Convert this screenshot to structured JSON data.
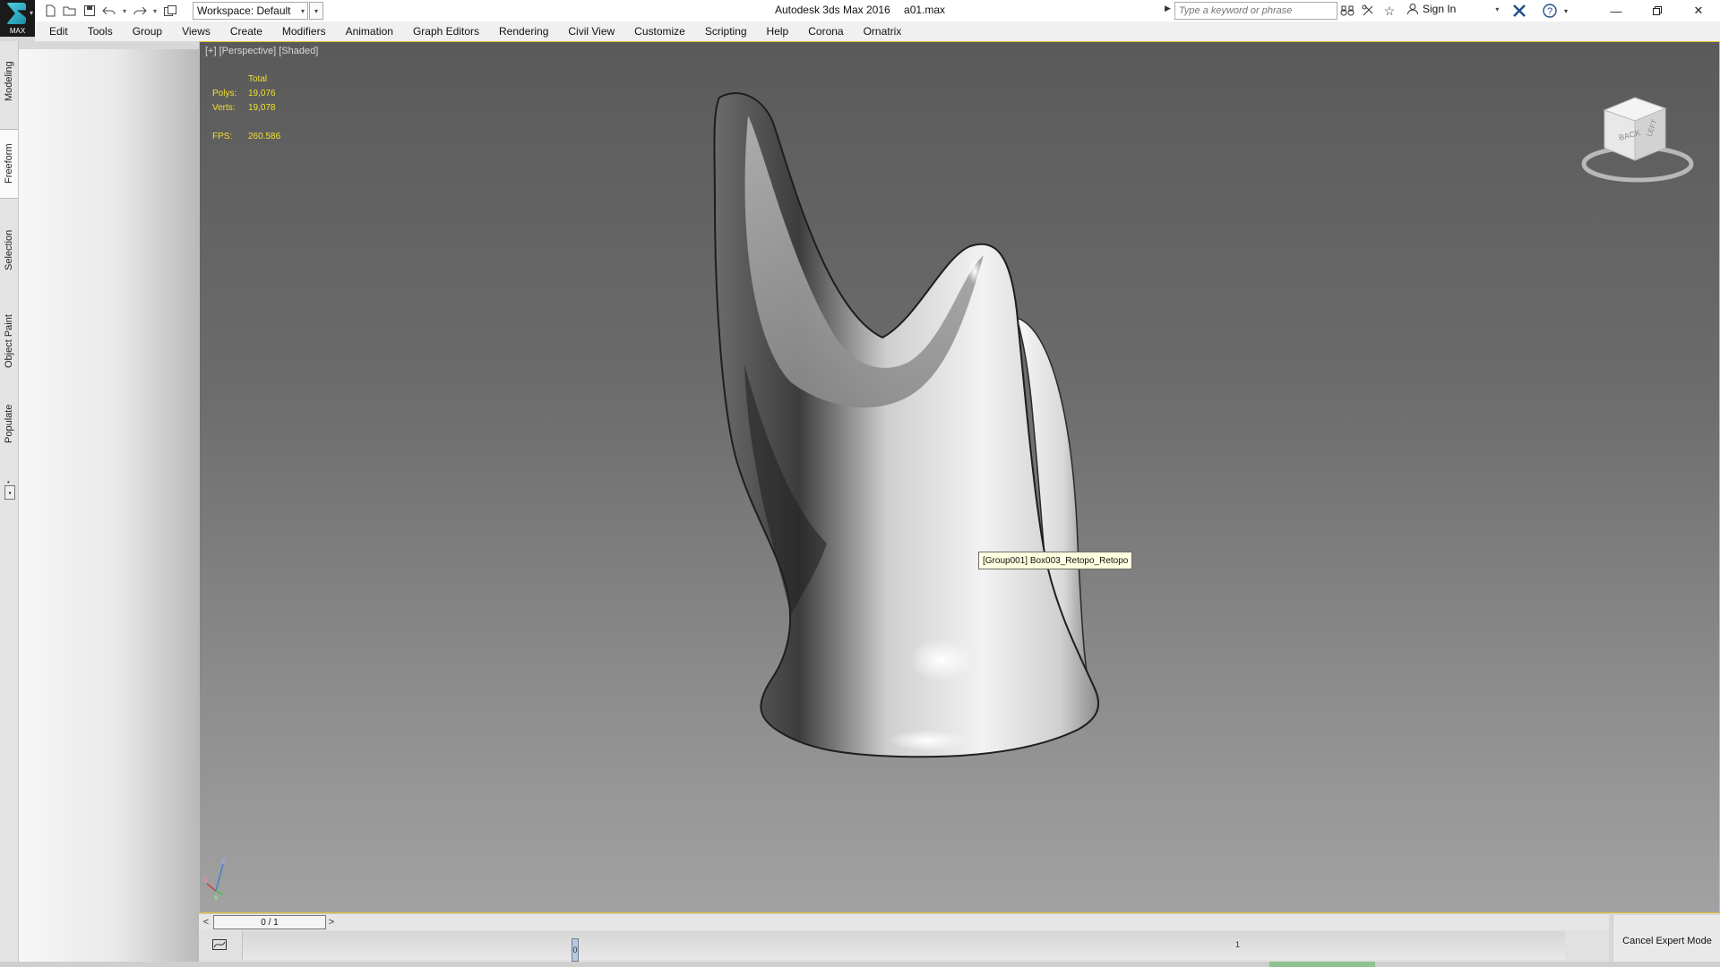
{
  "app": {
    "logo_label": "MAX",
    "title": "Autodesk 3ds Max 2016",
    "file": "a01.max"
  },
  "quick_access": {
    "icons": [
      "new-file-icon",
      "open-file-icon",
      "save-icon",
      "undo-icon",
      "redo-icon",
      "project-folder-icon"
    ]
  },
  "workspace": {
    "value": "Workspace: Default"
  },
  "search": {
    "placeholder": "Type a keyword or phrase"
  },
  "account": {
    "sign_in": "Sign In"
  },
  "menu": {
    "items": [
      "Edit",
      "Tools",
      "Group",
      "Views",
      "Create",
      "Modifiers",
      "Animation",
      "Graph Editors",
      "Rendering",
      "Civil View",
      "Customize",
      "Scripting",
      "Help",
      "Corona",
      "Ornatrix"
    ]
  },
  "ribbon_tabs": [
    "Modeling",
    "Freeform",
    "Selection",
    "Object Paint",
    "Populate"
  ],
  "ribbon_active_tab": "Freeform",
  "viewport": {
    "label": "[+] [Perspective] [Shaded]",
    "stats": {
      "header": "Total",
      "polys_label": "Polys:",
      "polys": "19,076",
      "verts_label": "Verts:",
      "verts": "19,078",
      "fps_label": "FPS:",
      "fps": "260.586"
    },
    "tooltip": "[Group001] Box003_Retopo_Retopo",
    "viewcube": {
      "face": "BACK",
      "side": "LEFT"
    },
    "axis": {
      "x": "x",
      "y": "y",
      "z": "z"
    },
    "border_color": "#e4c230"
  },
  "time_slider": {
    "prev": "<",
    "next": ">",
    "position": "0 / 1"
  },
  "track_bar": {
    "key_label": "0",
    "tick_label": "1"
  },
  "expert_mode": {
    "button": "Cancel Expert Mode"
  },
  "colors": {
    "stats_text": "#f0e030",
    "viewport_top": "#5a5a5a",
    "viewport_bottom": "#a2a2a2",
    "tooltip_bg": "#ffffe1"
  }
}
